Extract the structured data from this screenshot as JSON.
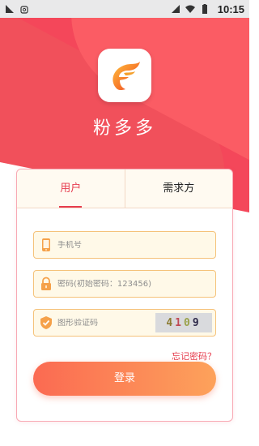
{
  "status_bar": {
    "time": "10:15"
  },
  "app": {
    "name": "粉多多"
  },
  "tabs": [
    {
      "label": "用户",
      "active": true
    },
    {
      "label": "需求方",
      "active": false
    }
  ],
  "form": {
    "phone_placeholder": "手机号",
    "password_placeholder": "密码(初始密码：123456)",
    "captcha_placeholder": "图形验证码",
    "captcha_digits": [
      "4",
      "1",
      "0",
      "9"
    ],
    "forgot_label": "忘记密码？",
    "login_label": "登录"
  },
  "colors": {
    "brand_red": "#f4475a",
    "accent": "#e63d4e",
    "button_start": "#fb6a52",
    "button_end": "#fda25b"
  },
  "icons": [
    "notification-icon",
    "android-icon",
    "wifi-icon",
    "signal-icon",
    "battery-icon",
    "phone-icon",
    "lock-icon",
    "shield-check-icon"
  ]
}
